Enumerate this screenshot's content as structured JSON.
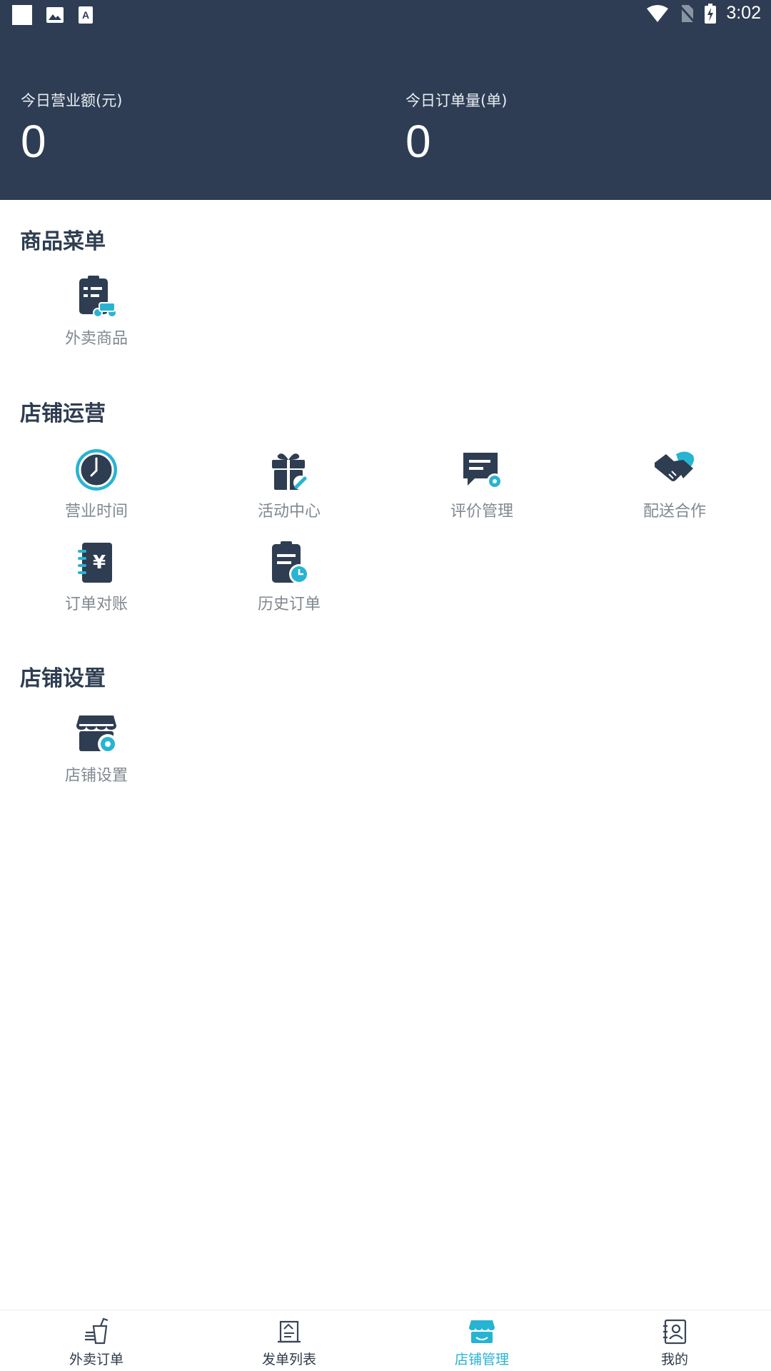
{
  "status_bar": {
    "time": "3:02",
    "left_icons": [
      "square-icon",
      "image-icon",
      "font-icon"
    ],
    "right_icons": [
      "wifi-icon",
      "no-sim-icon",
      "battery-charging-icon"
    ]
  },
  "stats": {
    "revenue_label": "今日营业额(元)",
    "revenue_value": "0",
    "orders_label": "今日订单量(单)",
    "orders_value": "0"
  },
  "sections": {
    "goods": {
      "title": "商品菜单",
      "items": [
        {
          "label": "外卖商品",
          "icon": "takeout-goods-icon"
        }
      ]
    },
    "operations": {
      "title": "店铺运营",
      "items": [
        {
          "label": "营业时间",
          "icon": "clock-icon"
        },
        {
          "label": "活动中心",
          "icon": "gift-icon"
        },
        {
          "label": "评价管理",
          "icon": "review-icon"
        },
        {
          "label": "配送合作",
          "icon": "handshake-icon"
        },
        {
          "label": "订单对账",
          "icon": "ledger-icon"
        },
        {
          "label": "历史订单",
          "icon": "order-history-icon"
        }
      ]
    },
    "settings": {
      "title": "店铺设置",
      "items": [
        {
          "label": "店铺设置",
          "icon": "store-settings-icon"
        }
      ]
    }
  },
  "bottom_nav": {
    "items": [
      {
        "label": "外卖订单",
        "icon": "takeout-cup-icon"
      },
      {
        "label": "发单列表",
        "icon": "dispatch-list-icon"
      },
      {
        "label": "店铺管理",
        "icon": "store-icon",
        "active": true
      },
      {
        "label": "我的",
        "icon": "profile-icon"
      }
    ]
  },
  "colors": {
    "header_bg": "#2e3d54",
    "icon_dark": "#2e3d51",
    "accent": "#27b4d3",
    "label_gray": "#808890"
  }
}
